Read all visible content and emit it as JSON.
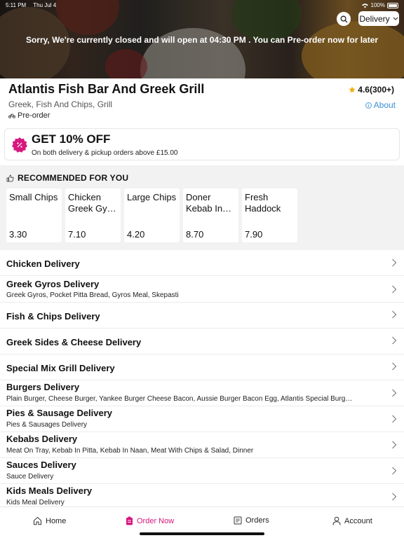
{
  "status_bar": {
    "time": "5:11 PM",
    "date": "Thu Jul 4",
    "battery": "100%"
  },
  "hero": {
    "closed_message": "Sorry, We're currently closed and will open at 04:30 PM . You can Pre-order now for later",
    "delivery_mode": "Delivery"
  },
  "restaurant": {
    "name": "Atlantis Fish Bar And Greek Grill",
    "rating": "4.6(300+)",
    "cuisines": "Greek, Fish And Chips, Grill",
    "about_label": "About",
    "preorder_label": "Pre-order"
  },
  "offer": {
    "title": "GET 10% OFF",
    "subtitle": "On both delivery & pickup orders above £15.00"
  },
  "recommended": {
    "heading": "RECOMMENDED FOR YOU",
    "items": [
      {
        "name": "Small Chips",
        "price": "3.30"
      },
      {
        "name": "Chicken Greek Gy…",
        "price": "7.10"
      },
      {
        "name": "Large Chips",
        "price": "4.20"
      },
      {
        "name": "Doner Kebab In…",
        "price": "8.70"
      },
      {
        "name": "Fresh Haddock",
        "price": "7.90"
      }
    ]
  },
  "categories": [
    {
      "title": "Chicken Delivery",
      "description": ""
    },
    {
      "title": "Greek Gyros Delivery",
      "description": "Greek Gyros, Pocket Pitta Bread, Gyros Meal, Skepasti"
    },
    {
      "title": "Fish & Chips Delivery",
      "description": ""
    },
    {
      "title": "Greek Sides & Cheese Delivery",
      "description": ""
    },
    {
      "title": "Special Mix Grill Delivery",
      "description": ""
    },
    {
      "title": "Burgers Delivery",
      "description": "Plain Burger, Cheese Burger, Yankee Burger Cheese Bacon, Aussie Burger Bacon Egg, Atlantis Special Burg…"
    },
    {
      "title": "Pies & Sausage Delivery",
      "description": "Pies & Sausages Delivery"
    },
    {
      "title": "Kebabs Delivery",
      "description": "Meat On Tray, Kebab In Pitta, Kebab In Naan, Meat With Chips & Salad, Dinner"
    },
    {
      "title": "Sauces Delivery",
      "description": "Sauce Delivery"
    },
    {
      "title": "Kids Meals Delivery",
      "description": "Kids Meal Delivery"
    }
  ],
  "tabs": [
    {
      "label": "Home",
      "icon": "home-icon"
    },
    {
      "label": "Order Now",
      "icon": "order-icon"
    },
    {
      "label": "Orders",
      "icon": "receipt-icon"
    },
    {
      "label": "Account",
      "icon": "person-icon"
    }
  ],
  "colors": {
    "accent": "#d6177f",
    "link": "#3a8fd8",
    "star": "#f2a900"
  }
}
